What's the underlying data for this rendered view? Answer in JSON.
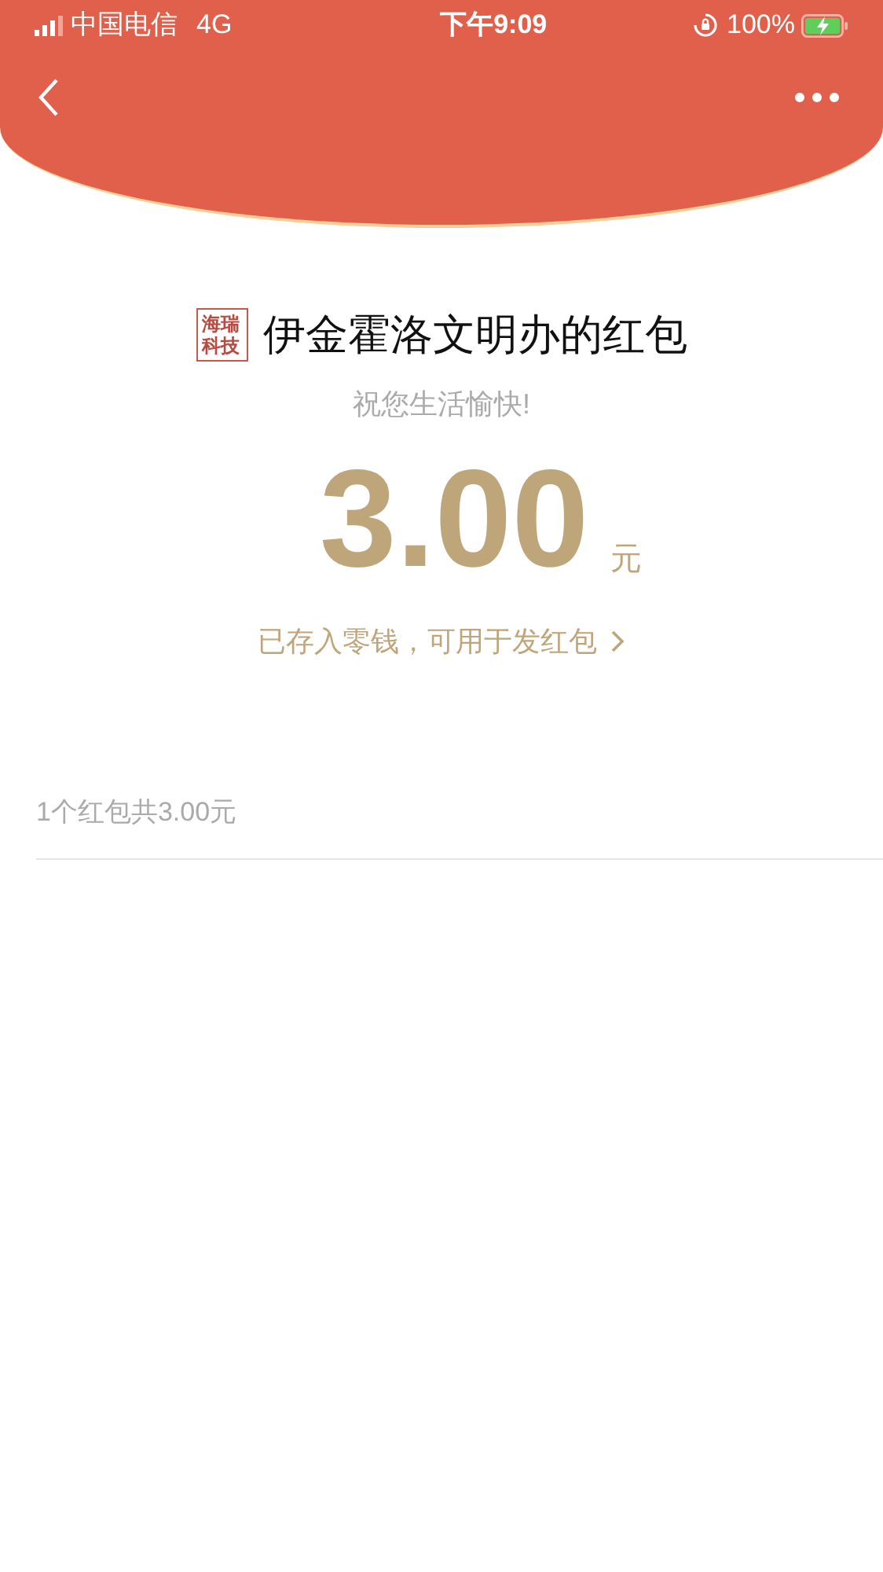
{
  "status_bar": {
    "carrier": "中国电信",
    "network": "4G",
    "time": "下午9:09",
    "battery": "100%"
  },
  "sender": {
    "logo": "海瑞科技",
    "title": "伊金霍洛文明办的红包",
    "greeting": "祝您生活愉快!"
  },
  "amount": {
    "value": "3.00",
    "unit": "元",
    "note": "已存入零钱，可用于发红包"
  },
  "summary": "1个红包共3.00元"
}
